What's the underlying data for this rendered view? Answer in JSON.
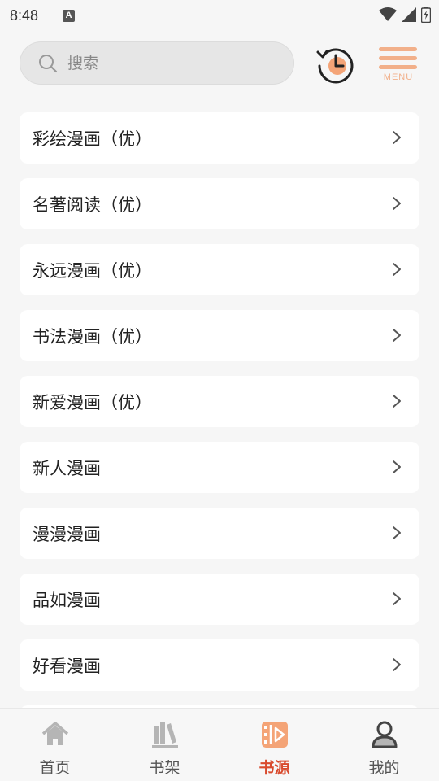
{
  "status_bar": {
    "time": "8:48",
    "notification_icon": "A"
  },
  "search": {
    "placeholder": "搜索"
  },
  "menu": {
    "label": "MENU"
  },
  "source_list": {
    "items": [
      {
        "label": "彩绘漫画（优）"
      },
      {
        "label": "名著阅读（优）"
      },
      {
        "label": "永远漫画（优）"
      },
      {
        "label": "书法漫画（优）"
      },
      {
        "label": "新爱漫画（优）"
      },
      {
        "label": "新人漫画"
      },
      {
        "label": "漫漫漫画"
      },
      {
        "label": "品如漫画"
      },
      {
        "label": "好看漫画"
      }
    ]
  },
  "bottom_nav": {
    "items": [
      {
        "label": "首页",
        "icon": "home-icon",
        "active": false
      },
      {
        "label": "书架",
        "icon": "bookshelf-icon",
        "active": false
      },
      {
        "label": "书源",
        "icon": "book-source-icon",
        "active": true
      },
      {
        "label": "我的",
        "icon": "profile-icon",
        "active": false
      }
    ]
  },
  "colors": {
    "accent": "#f2b08a",
    "active_tab": "#d94a2d",
    "background": "#f6f6f6",
    "card": "#ffffff"
  }
}
